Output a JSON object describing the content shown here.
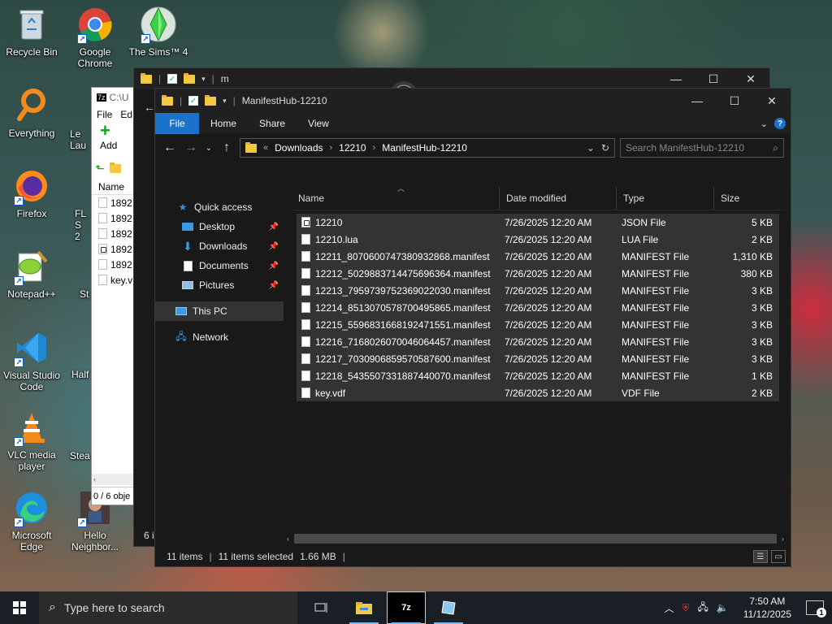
{
  "desktop": {
    "icons": [
      {
        "label": "Recycle Bin"
      },
      {
        "label": "Google Chrome"
      },
      {
        "label": "The Sims™ 4"
      },
      {
        "label": "Everything"
      },
      {
        "label": "Firefox"
      },
      {
        "label": "Notepad++"
      },
      {
        "label": "Visual Studio Code"
      },
      {
        "label": "VLC media player"
      },
      {
        "label": "Microsoft Edge"
      },
      {
        "label": "Hello Neighbor..."
      }
    ],
    "partial": {
      "le": "Le",
      "lau": "Lau",
      "fl": "FL S",
      "fl2": "2",
      "st": "St",
      "half": "Half",
      "stea": "Stea"
    }
  },
  "sevenzip": {
    "title": "C:\\U",
    "menu": [
      "File",
      "Ed"
    ],
    "add_label": "Add",
    "e_label": "E",
    "header": "Name",
    "items": [
      "1892",
      "1892",
      "1892",
      "1892",
      "1892",
      "key.v"
    ],
    "status": "0 / 6 obje"
  },
  "back_window": {
    "title": "m",
    "status": "6 i"
  },
  "explorer": {
    "title": "ManifestHub-12210",
    "ribbon": {
      "file": "File",
      "home": "Home",
      "share": "Share",
      "view": "View"
    },
    "breadcrumb": [
      "Downloads",
      "12210",
      "ManifestHub-12210"
    ],
    "search_placeholder": "Search ManifestHub-12210",
    "nav": {
      "quick_access": "Quick access",
      "desktop": "Desktop",
      "downloads": "Downloads",
      "documents": "Documents",
      "pictures": "Pictures",
      "this_pc": "This PC",
      "network": "Network"
    },
    "columns": {
      "name": "Name",
      "date": "Date modified",
      "type": "Type",
      "size": "Size"
    },
    "files": [
      {
        "name": "12210",
        "date": "7/26/2025 12:20 AM",
        "type": "JSON File",
        "size": "5 KB"
      },
      {
        "name": "12210.lua",
        "date": "7/26/2025 12:20 AM",
        "type": "LUA File",
        "size": "2 KB"
      },
      {
        "name": "12211_8070600747380932868.manifest",
        "date": "7/26/2025 12:20 AM",
        "type": "MANIFEST File",
        "size": "1,310 KB"
      },
      {
        "name": "12212_5029883714475696364.manifest",
        "date": "7/26/2025 12:20 AM",
        "type": "MANIFEST File",
        "size": "380 KB"
      },
      {
        "name": "12213_7959739752369022030.manifest",
        "date": "7/26/2025 12:20 AM",
        "type": "MANIFEST File",
        "size": "3 KB"
      },
      {
        "name": "12214_8513070578700495865.manifest",
        "date": "7/26/2025 12:20 AM",
        "type": "MANIFEST File",
        "size": "3 KB"
      },
      {
        "name": "12215_5596831668192471551.manifest",
        "date": "7/26/2025 12:20 AM",
        "type": "MANIFEST File",
        "size": "3 KB"
      },
      {
        "name": "12216_7168026070046064457.manifest",
        "date": "7/26/2025 12:20 AM",
        "type": "MANIFEST File",
        "size": "3 KB"
      },
      {
        "name": "12217_7030906859570587600.manifest",
        "date": "7/26/2025 12:20 AM",
        "type": "MANIFEST File",
        "size": "3 KB"
      },
      {
        "name": "12218_5435507331887440070.manifest",
        "date": "7/26/2025 12:20 AM",
        "type": "MANIFEST File",
        "size": "1 KB"
      },
      {
        "name": "key.vdf",
        "date": "7/26/2025 12:20 AM",
        "type": "VDF File",
        "size": "2 KB"
      }
    ],
    "status": {
      "count": "11 items",
      "selected": "11 items selected",
      "size": "1.66 MB"
    }
  },
  "taskbar": {
    "search_placeholder": "Type here to search",
    "time": "7:50 AM",
    "date": "11/12/2025",
    "notifications": "1"
  },
  "colors": {
    "accent": "#1a73c9",
    "selection": "#333333",
    "folder": "#f3c940"
  }
}
